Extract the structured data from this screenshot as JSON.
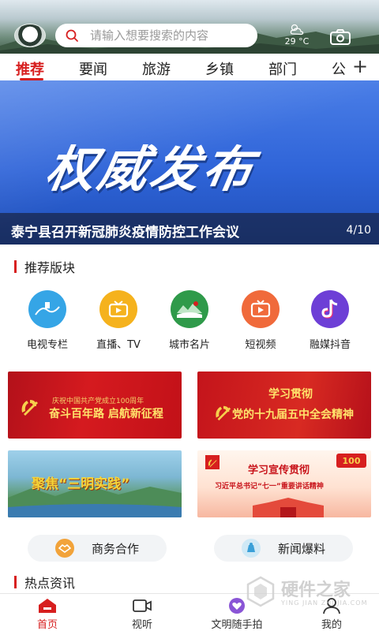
{
  "header": {
    "search_placeholder": "请输入想要搜索的内容",
    "weather_temp": "29 °C"
  },
  "tabs": [
    {
      "label": "推荐",
      "active": true
    },
    {
      "label": "要闻"
    },
    {
      "label": "旅游"
    },
    {
      "label": "乡镇"
    },
    {
      "label": "部门"
    },
    {
      "label": "公"
    }
  ],
  "banner": {
    "art_text": "权威发布",
    "title": "泰宁县召开新冠肺炎疫情防控工作会议",
    "page": "4/10"
  },
  "recommend": {
    "title": "推荐版块",
    "items": [
      {
        "label": "电视专栏",
        "icon": "tv-column-icon",
        "color": "#35a5e6"
      },
      {
        "label": "直播、TV",
        "icon": "live-tv-icon",
        "color": "#f5b21d"
      },
      {
        "label": "城市名片",
        "icon": "city-card-icon",
        "color": "#2f9a4a"
      },
      {
        "label": "短视频",
        "icon": "short-video-icon",
        "color": "#f06a3b"
      },
      {
        "label": "融媒抖音",
        "icon": "douyin-icon",
        "color": "#6d3fd6"
      }
    ]
  },
  "cards": [
    {
      "line1": "庆祝中国共产党成立100周年",
      "line2": "奋斗百年路 启航新征程"
    },
    {
      "line1": "学习贯彻",
      "line2": "党的十九届五中全会精神"
    },
    {
      "line1": "聚焦“三明实践”"
    },
    {
      "line1": "学习宣传贯彻",
      "line2": "习近平总书记“七一”重要讲话精神"
    }
  ],
  "pills": [
    {
      "label": "商务合作"
    },
    {
      "label": "新闻爆料"
    }
  ],
  "hot": {
    "title": "热点资讯"
  },
  "bottom_nav": [
    {
      "label": "首页",
      "active": true
    },
    {
      "label": "视听"
    },
    {
      "label": "文明随手拍"
    },
    {
      "label": "我的"
    }
  ],
  "watermark": {
    "text": "硬件之家",
    "sub": "YING JIAN ZHI JIA.COM"
  },
  "colors": {
    "accent": "#d71f1f",
    "banner": "#2f64d8"
  }
}
